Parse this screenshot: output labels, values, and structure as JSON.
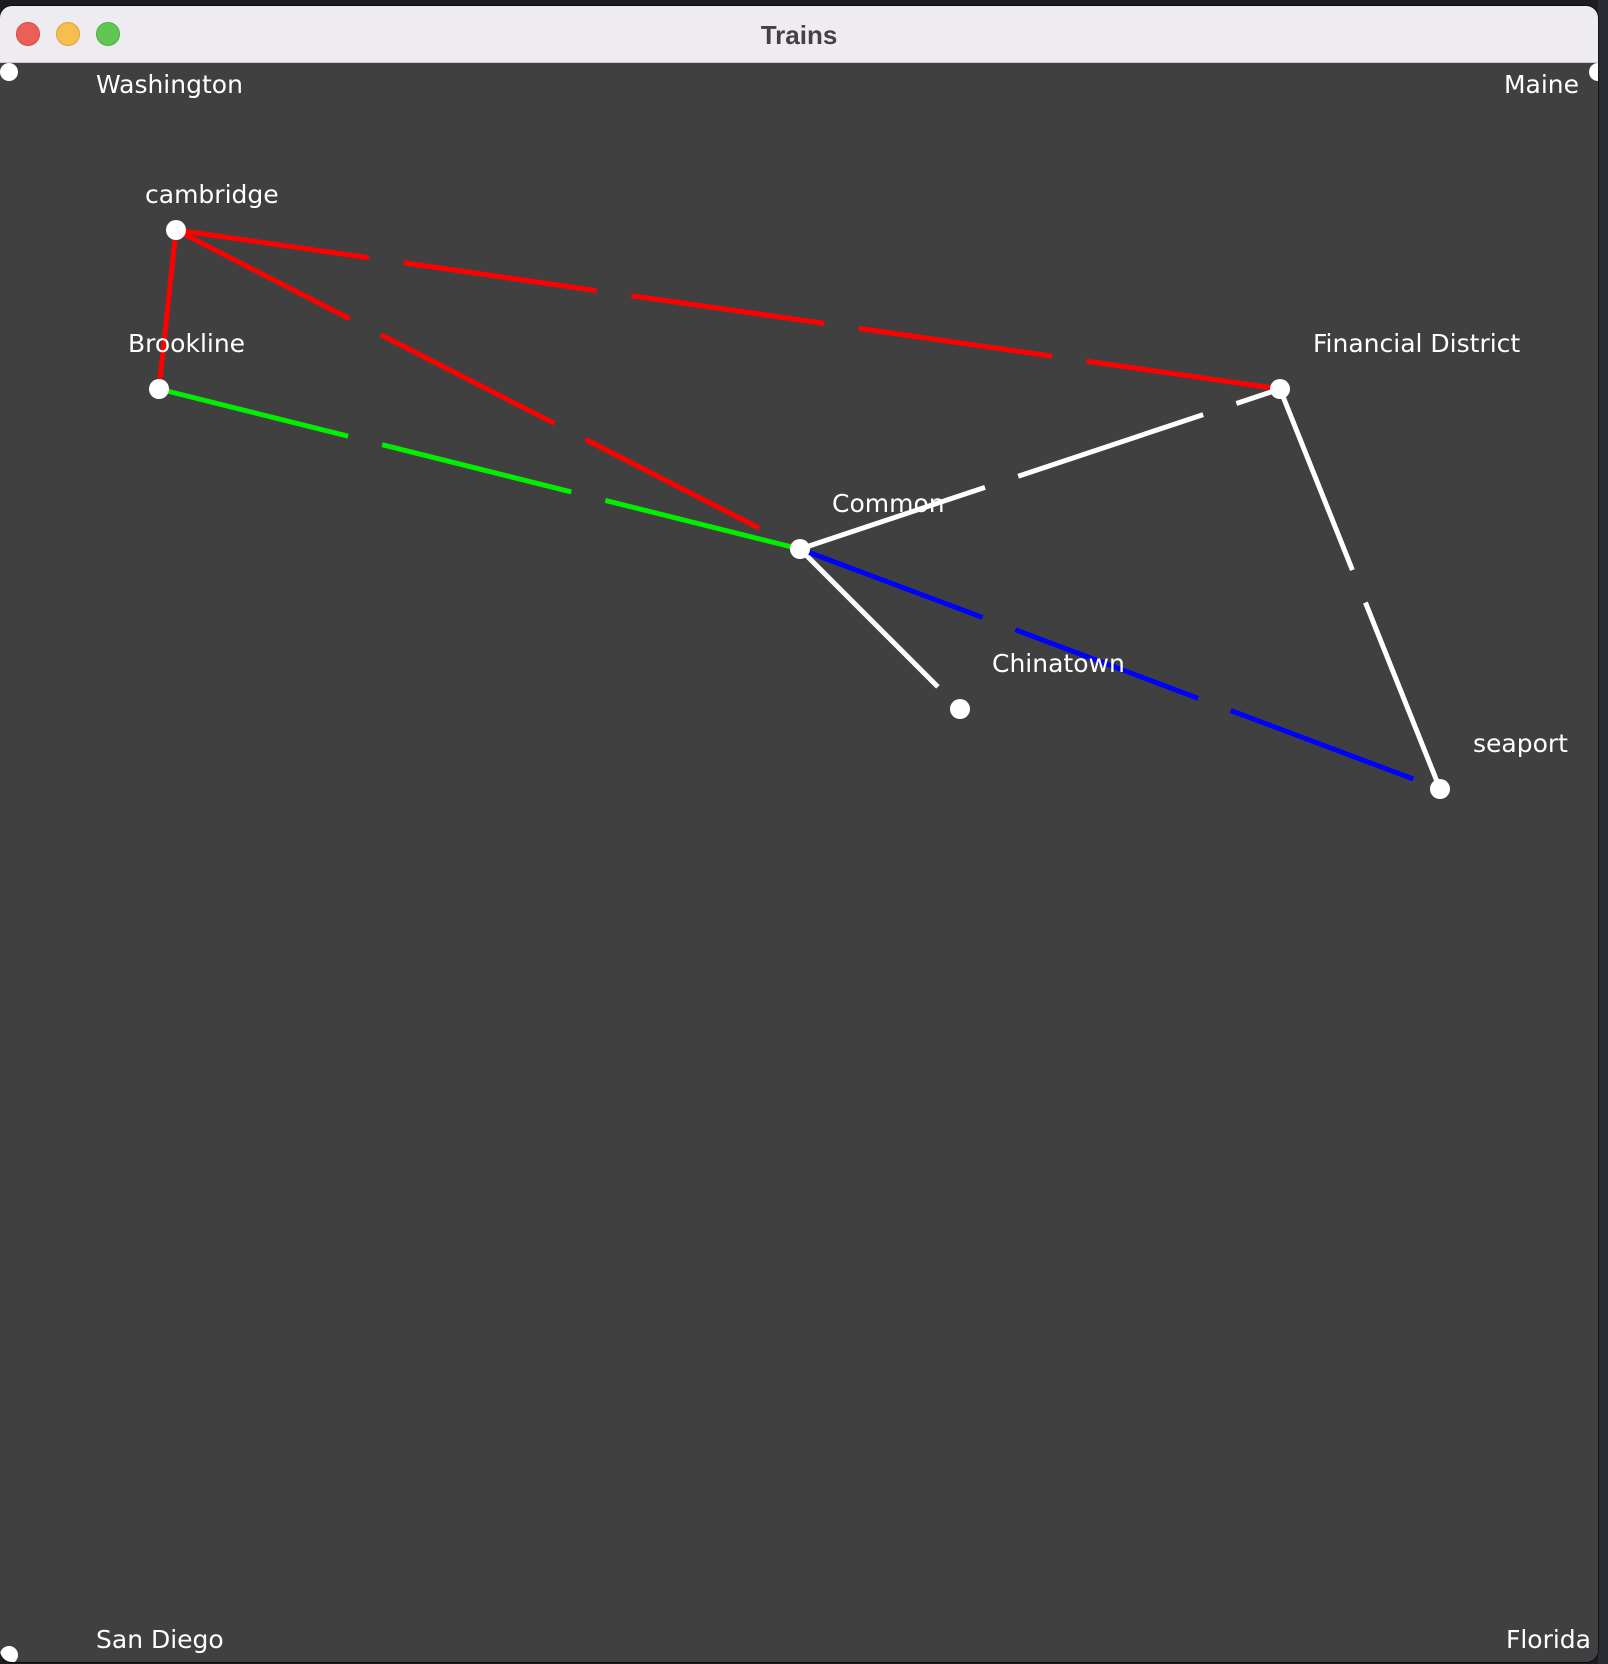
{
  "window": {
    "title": "Trains"
  },
  "corners": {
    "top_left": "Washington",
    "top_right": "Maine",
    "bottom_left": "San Diego",
    "bottom_right": "Florida"
  },
  "stations": [
    {
      "id": "cambridge",
      "label": "cambridge"
    },
    {
      "id": "brookline",
      "label": "Brookline"
    },
    {
      "id": "financial-district",
      "label": "Financial District"
    },
    {
      "id": "common",
      "label": "Common"
    },
    {
      "id": "chinatown",
      "label": "Chinatown"
    },
    {
      "id": "seaport",
      "label": "seaport"
    }
  ],
  "connections": [
    {
      "from": "cambridge",
      "to": "financial-district",
      "color": "#ff0000"
    },
    {
      "from": "cambridge",
      "to": "common",
      "color": "#ff0000"
    },
    {
      "from": "cambridge",
      "to": "brookline",
      "color": "#ff0000"
    },
    {
      "from": "brookline",
      "to": "common",
      "color": "#00ee00"
    },
    {
      "from": "common",
      "to": "financial-district",
      "color": "#ffffff"
    },
    {
      "from": "financial-district",
      "to": "seaport",
      "color": "#ffffff"
    },
    {
      "from": "common",
      "to": "chinatown",
      "color": "#ffffff"
    },
    {
      "from": "common",
      "to": "seaport",
      "color": "#0000ff"
    }
  ],
  "colors": {
    "canvas_background": "#404040",
    "station_dot": "#ffffff",
    "label_text": "#ffffff"
  },
  "icons": {
    "close": "close-button-icon",
    "minimize": "minimize-button-icon",
    "zoom": "zoom-button-icon"
  }
}
